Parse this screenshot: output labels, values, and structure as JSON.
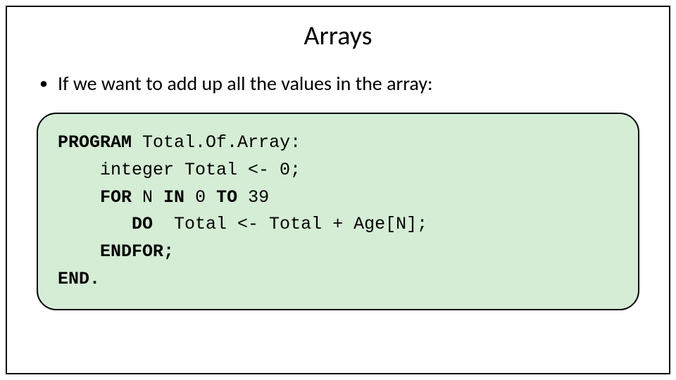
{
  "title": "Arrays",
  "bullet": "If we want to add up all the values in the array:",
  "code": {
    "kw_program": "PROGRAM",
    "prog_name": " Total.Of.Array:",
    "line2": "    integer Total <- 0;",
    "kw_for": "    FOR",
    "for_mid": " N ",
    "kw_in": "IN",
    "for_tail": " 0 ",
    "kw_to": "TO",
    "for_end": " 39",
    "kw_do": "       DO",
    "do_body": "  Total <- Total + Age[N];",
    "kw_endfor": "    ENDFOR;",
    "kw_end": "END."
  }
}
